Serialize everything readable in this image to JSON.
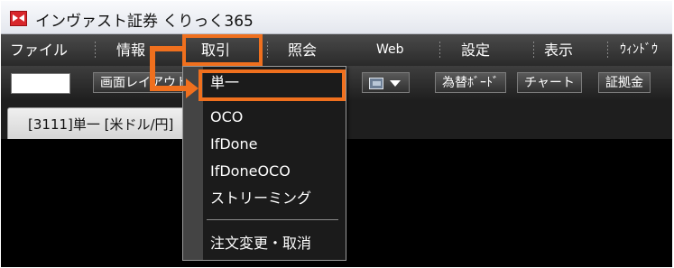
{
  "window": {
    "title": "インヴァスト証券 くりっく365"
  },
  "menubar": {
    "items": [
      {
        "label": "ファイル"
      },
      {
        "label": "情報"
      },
      {
        "label": "取引"
      },
      {
        "label": "照会"
      },
      {
        "label": "Web"
      },
      {
        "label": "設定"
      },
      {
        "label": "表示"
      },
      {
        "label": "ｳｨﾝﾄﾞｳ"
      }
    ]
  },
  "toolbar": {
    "layout_button": "画面レイアウト",
    "fx_board_button": "為替ﾎﾞｰﾄﾞ",
    "chart_button": "チャート",
    "margin_button": "証拠金"
  },
  "tab": {
    "label": "[3111]単一 [米ドル/円]"
  },
  "dropdown": {
    "items": [
      {
        "label": "単一"
      },
      {
        "label": "OCO"
      },
      {
        "label": "IfDone"
      },
      {
        "label": "IfDoneOCO"
      },
      {
        "label": "ストリーミング"
      },
      {
        "label": "注文変更・取消"
      }
    ]
  },
  "colors": {
    "highlight": "#f0701e",
    "menubar": "#2a2a2a",
    "menu_text": "#ffffff"
  }
}
